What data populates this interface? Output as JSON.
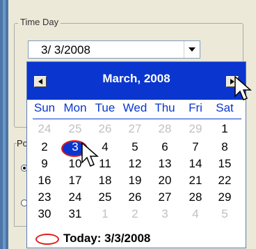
{
  "group": {
    "title": "Time Day"
  },
  "date_combo": {
    "value": "3/  3/2008"
  },
  "background_fragment": {
    "label": "Po"
  },
  "calendar": {
    "month_title": "March, 2008",
    "weekdays": [
      "Sun",
      "Mon",
      "Tue",
      "Wed",
      "Thu",
      "Fri",
      "Sat"
    ],
    "rows": [
      [
        "24",
        "25",
        "26",
        "27",
        "28",
        "29",
        "1"
      ],
      [
        "2",
        "3",
        "4",
        "5",
        "6",
        "7",
        "8"
      ],
      [
        "9",
        "10",
        "11",
        "12",
        "13",
        "14",
        "15"
      ],
      [
        "16",
        "17",
        "18",
        "19",
        "20",
        "21",
        "22"
      ],
      [
        "23",
        "24",
        "25",
        "26",
        "27",
        "28",
        "29"
      ],
      [
        "30",
        "31",
        "1",
        "2",
        "3",
        "4",
        "5"
      ]
    ],
    "selected_day": "3",
    "today_label": "Today: 3/3/2008"
  },
  "colors": {
    "header_blue": "#0a36cf",
    "highlight_red": "#e31b1b",
    "other_month_gray": "#c0c0c0"
  },
  "icons": {
    "prev": "left-triangle-icon",
    "next": "right-triangle-icon",
    "dropdown": "chevron-down-icon",
    "cursor": "mouse-pointer-icon"
  }
}
